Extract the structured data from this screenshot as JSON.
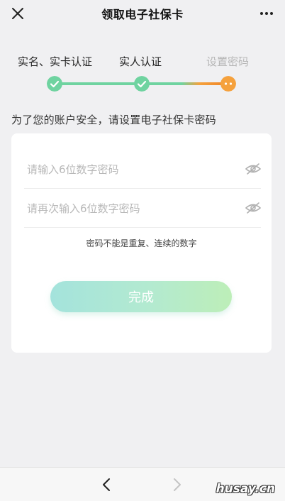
{
  "nav": {
    "title": "领取电子社保卡",
    "close_icon": "close-icon",
    "more_icon": "more-icon"
  },
  "steps": [
    {
      "label": "实名、实卡认证",
      "status": "done"
    },
    {
      "label": "实人认证",
      "status": "done"
    },
    {
      "label": "设置密码",
      "status": "current"
    }
  ],
  "colors": {
    "step_done": "#6fd3a0",
    "step_current": "#f5a13d",
    "background": "#f0f0f2"
  },
  "hint": "为了您的账户安全，请设置电子社保卡密码",
  "form": {
    "password_placeholder": "请输入6位数字密码",
    "password_value": "",
    "confirm_placeholder": "请再次输入6位数字密码",
    "confirm_value": "",
    "eye_icon": "eye-hidden-icon",
    "rule": "密码不能是重复、连续的数字",
    "submit_label": "完成"
  },
  "bottom": {
    "back_icon": "chevron-left-icon",
    "forward_icon": "chevron-right-icon",
    "watermark": "husay.cn"
  }
}
